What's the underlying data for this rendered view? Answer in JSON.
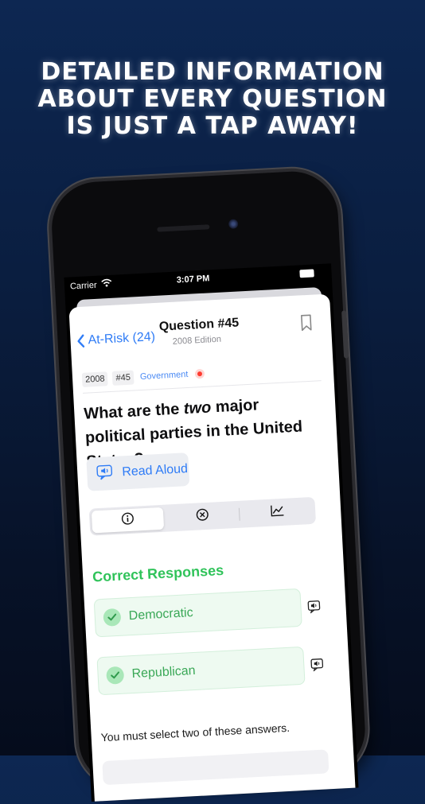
{
  "headline": {
    "lines": [
      "DETAILED INFORMATION",
      "ABOUT EVERY QUESTION",
      "IS JUST A TAP AWAY!"
    ]
  },
  "status_bar": {
    "carrier": "Carrier",
    "time": "3:07 PM"
  },
  "nav": {
    "back_label": "At-Risk (24)",
    "title": "Question #45",
    "subtitle": "2008 Edition"
  },
  "tags": {
    "year": "2008",
    "number": "#45",
    "category": "Government"
  },
  "question": {
    "prefix": "What are the ",
    "emphasis": "two",
    "suffix": " major political parties in the United States?"
  },
  "read_aloud": {
    "label": "Read Aloud"
  },
  "tabs": [
    {
      "icon": "info-icon"
    },
    {
      "icon": "x-circle-icon"
    },
    {
      "icon": "chart-icon"
    }
  ],
  "correct_responses": {
    "title": "Correct Responses",
    "answers": [
      "Democratic",
      "Republican"
    ],
    "note": "You must select two of these answers."
  },
  "colors": {
    "accent_blue": "#2f7cf6",
    "accent_green": "#30c35a",
    "background": "#0a1d3e"
  }
}
